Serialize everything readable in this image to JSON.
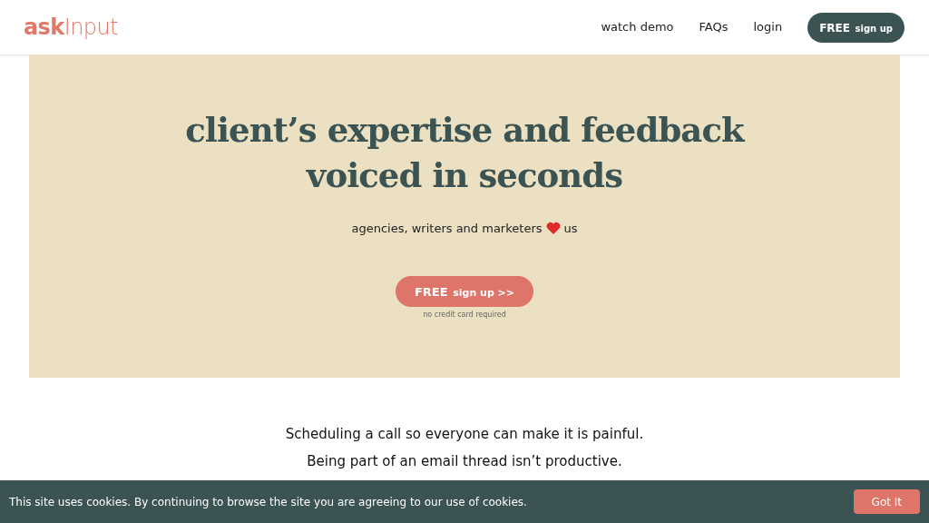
{
  "header": {
    "logo": {
      "part1": "ask",
      "part2": "Input"
    },
    "nav": [
      "watch demo",
      "FAQs",
      "login"
    ],
    "cta": {
      "strong": "FREE",
      "rest": "sign up"
    }
  },
  "hero": {
    "title_lines": [
      "client’s expertise and feedback",
      "voiced in seconds"
    ],
    "tagline_before": "agencies, writers and marketers",
    "tagline_after": "us",
    "cta": {
      "strong": "FREE",
      "rest": "sign up >>"
    },
    "note": "no credit card required"
  },
  "pain_points": [
    "Scheduling a call so everyone can make it is painful.",
    "Being part of an email thread isn’t productive."
  ],
  "cookie_bar": {
    "message": "This site uses cookies. By continuing to browse the site you are agreeing to our use of cookies.",
    "button": "Got It"
  }
}
